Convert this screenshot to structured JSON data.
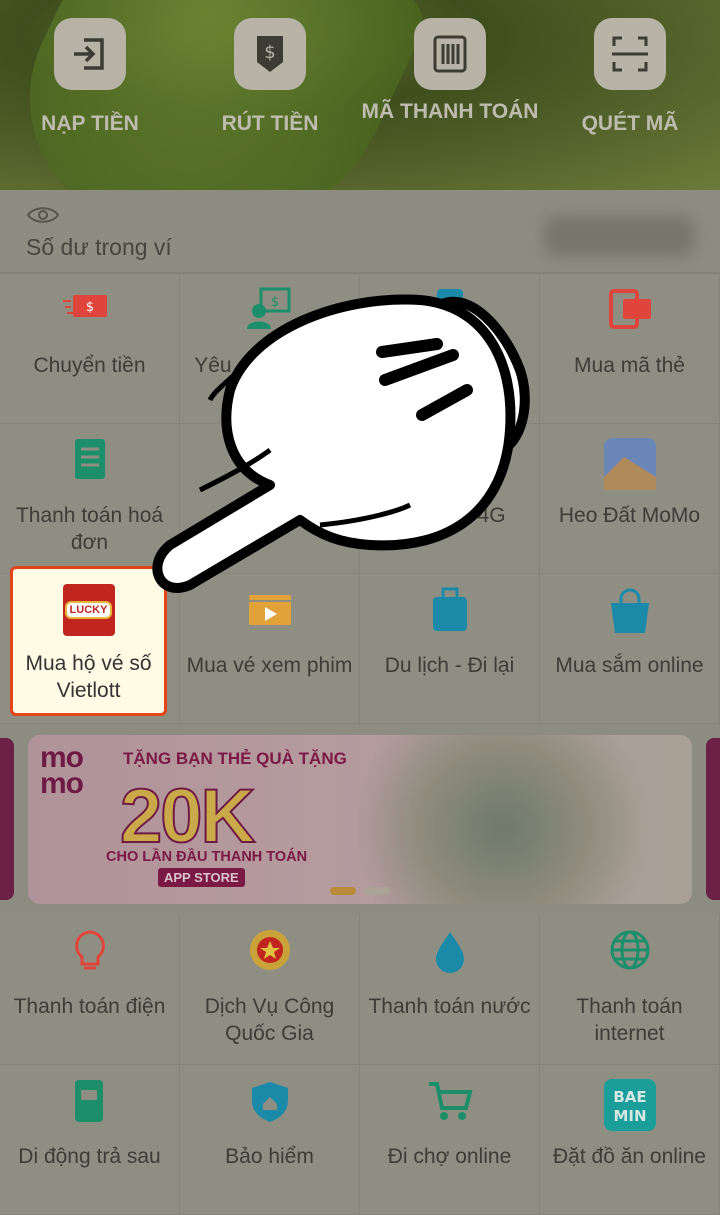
{
  "quick_actions": [
    {
      "label": "NẠP TIỀN",
      "icon": "deposit-icon"
    },
    {
      "label": "RÚT TIỀN",
      "icon": "withdraw-icon"
    },
    {
      "label": "MÃ THANH TOÁN",
      "icon": "barcode-icon"
    },
    {
      "label": "QUÉT MÃ",
      "icon": "scan-icon"
    }
  ],
  "balance": {
    "label": "Số dư trong ví",
    "icon": "eye-icon"
  },
  "services_top": [
    {
      "label": "Chuyển tiền",
      "icon": "transfer-icon",
      "color": "#e0453c"
    },
    {
      "label": "Yêu cầu chuyển tiền",
      "icon": "request-money-icon",
      "color": "#1c8f6a"
    },
    {
      "label": "",
      "icon": "phone-topup-icon",
      "color": "#1b8aa8"
    },
    {
      "label": "Mua mã thẻ",
      "icon": "card-code-icon",
      "color": "#e0453c"
    },
    {
      "label": "Thanh toán hoá đơn",
      "icon": "bill-icon",
      "color": "#1c8f6a"
    },
    {
      "label": "",
      "icon": "loan-icon",
      "color": "#1c8f6a"
    },
    {
      "label": "Data 3G/4G",
      "icon": "data-icon",
      "color": "#1b8aa8"
    },
    {
      "label": "Heo Đất MoMo",
      "icon": "piggy-icon",
      "color": "#3a79c0"
    },
    {
      "label": "Mua hộ vé số Vietlott",
      "icon": "lucky-icon",
      "color": "#c0261f"
    },
    {
      "label": "Mua vé xem phim",
      "icon": "movie-icon",
      "color": "#e2a23a"
    },
    {
      "label": "Du lịch -  Đi lại",
      "icon": "luggage-icon",
      "color": "#1b8aa8"
    },
    {
      "label": "Mua sắm online",
      "icon": "shopping-bag-icon",
      "color": "#1b8aa8"
    }
  ],
  "banner": {
    "brand": "mo mo",
    "line1": "TẶNG BẠN THẺ QUÀ TẶNG",
    "amount": "20K",
    "line2": "CHO LẦN ĐẦU THANH TOÁN",
    "tag": "APP STORE"
  },
  "services_bottom": [
    {
      "label": "Thanh toán điện",
      "icon": "lightbulb-icon",
      "color": "#e0453c"
    },
    {
      "label": "Dịch Vụ Công Quốc Gia",
      "icon": "emblem-icon",
      "color": "#c0261f"
    },
    {
      "label": "Thanh toán nước",
      "icon": "water-drop-icon",
      "color": "#1b8aa8"
    },
    {
      "label": "Thanh toán internet",
      "icon": "globe-icon",
      "color": "#1c8f6a"
    },
    {
      "label": "Di động trả sau",
      "icon": "postpaid-phone-icon",
      "color": "#1c8f6a"
    },
    {
      "label": "Bảo hiểm",
      "icon": "shield-icon",
      "color": "#1b8aa8"
    },
    {
      "label": "Đi chợ online",
      "icon": "cart-icon",
      "color": "#1c8f6a"
    },
    {
      "label": "Đặt đồ ăn online",
      "icon": "baemin-icon",
      "color": "#1b9e9a"
    }
  ],
  "highlight_color": "#e2451a"
}
